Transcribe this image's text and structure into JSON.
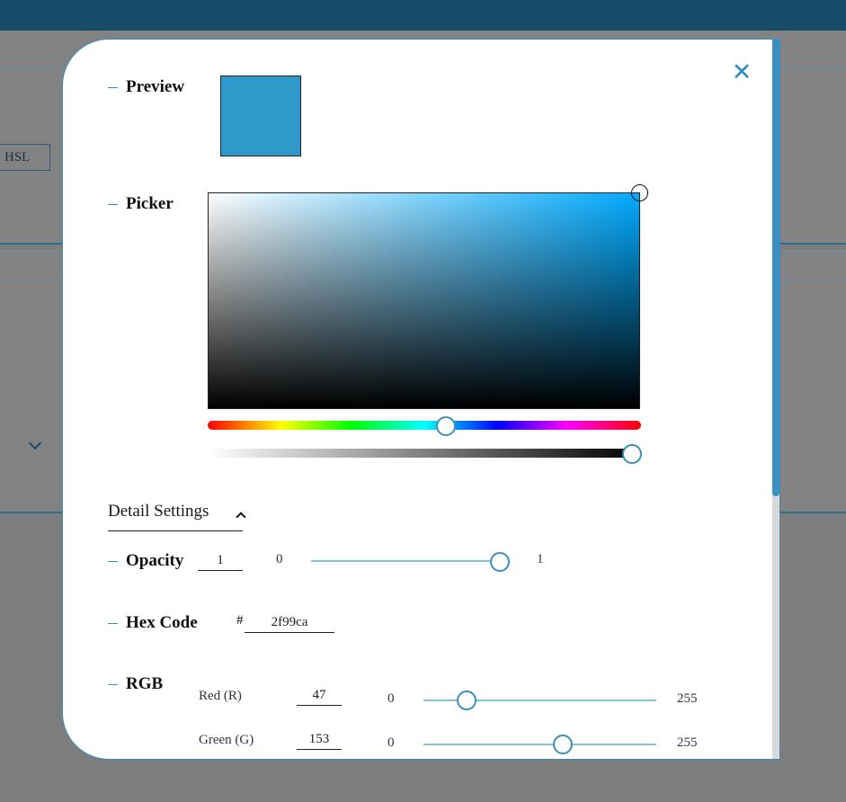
{
  "background": {
    "format_button_label": "HSL"
  },
  "modal": {
    "close_symbol": "✕",
    "preview_label": "Preview",
    "preview_color": "#2f99ca",
    "picker_label": "Picker",
    "hue_level": 0.55,
    "alpha_level": 1.0,
    "detail_settings_label": "Detail Settings",
    "opacity": {
      "label": "Opacity",
      "value": "1",
      "min": "0",
      "max": "1",
      "level": 1.0
    },
    "hex": {
      "label": "Hex Code",
      "prefix": "#",
      "value": "2f99ca"
    },
    "rgb": {
      "label": "RGB",
      "channels": [
        {
          "label": "Red (R)",
          "value": "47",
          "min": "0",
          "max": "255",
          "level": 0.184
        },
        {
          "label": "Green (G)",
          "value": "153",
          "min": "0",
          "max": "255",
          "level": 0.6
        }
      ]
    }
  },
  "colors": {
    "accent": "#2f8ec5",
    "top_bar": "#174c67"
  }
}
